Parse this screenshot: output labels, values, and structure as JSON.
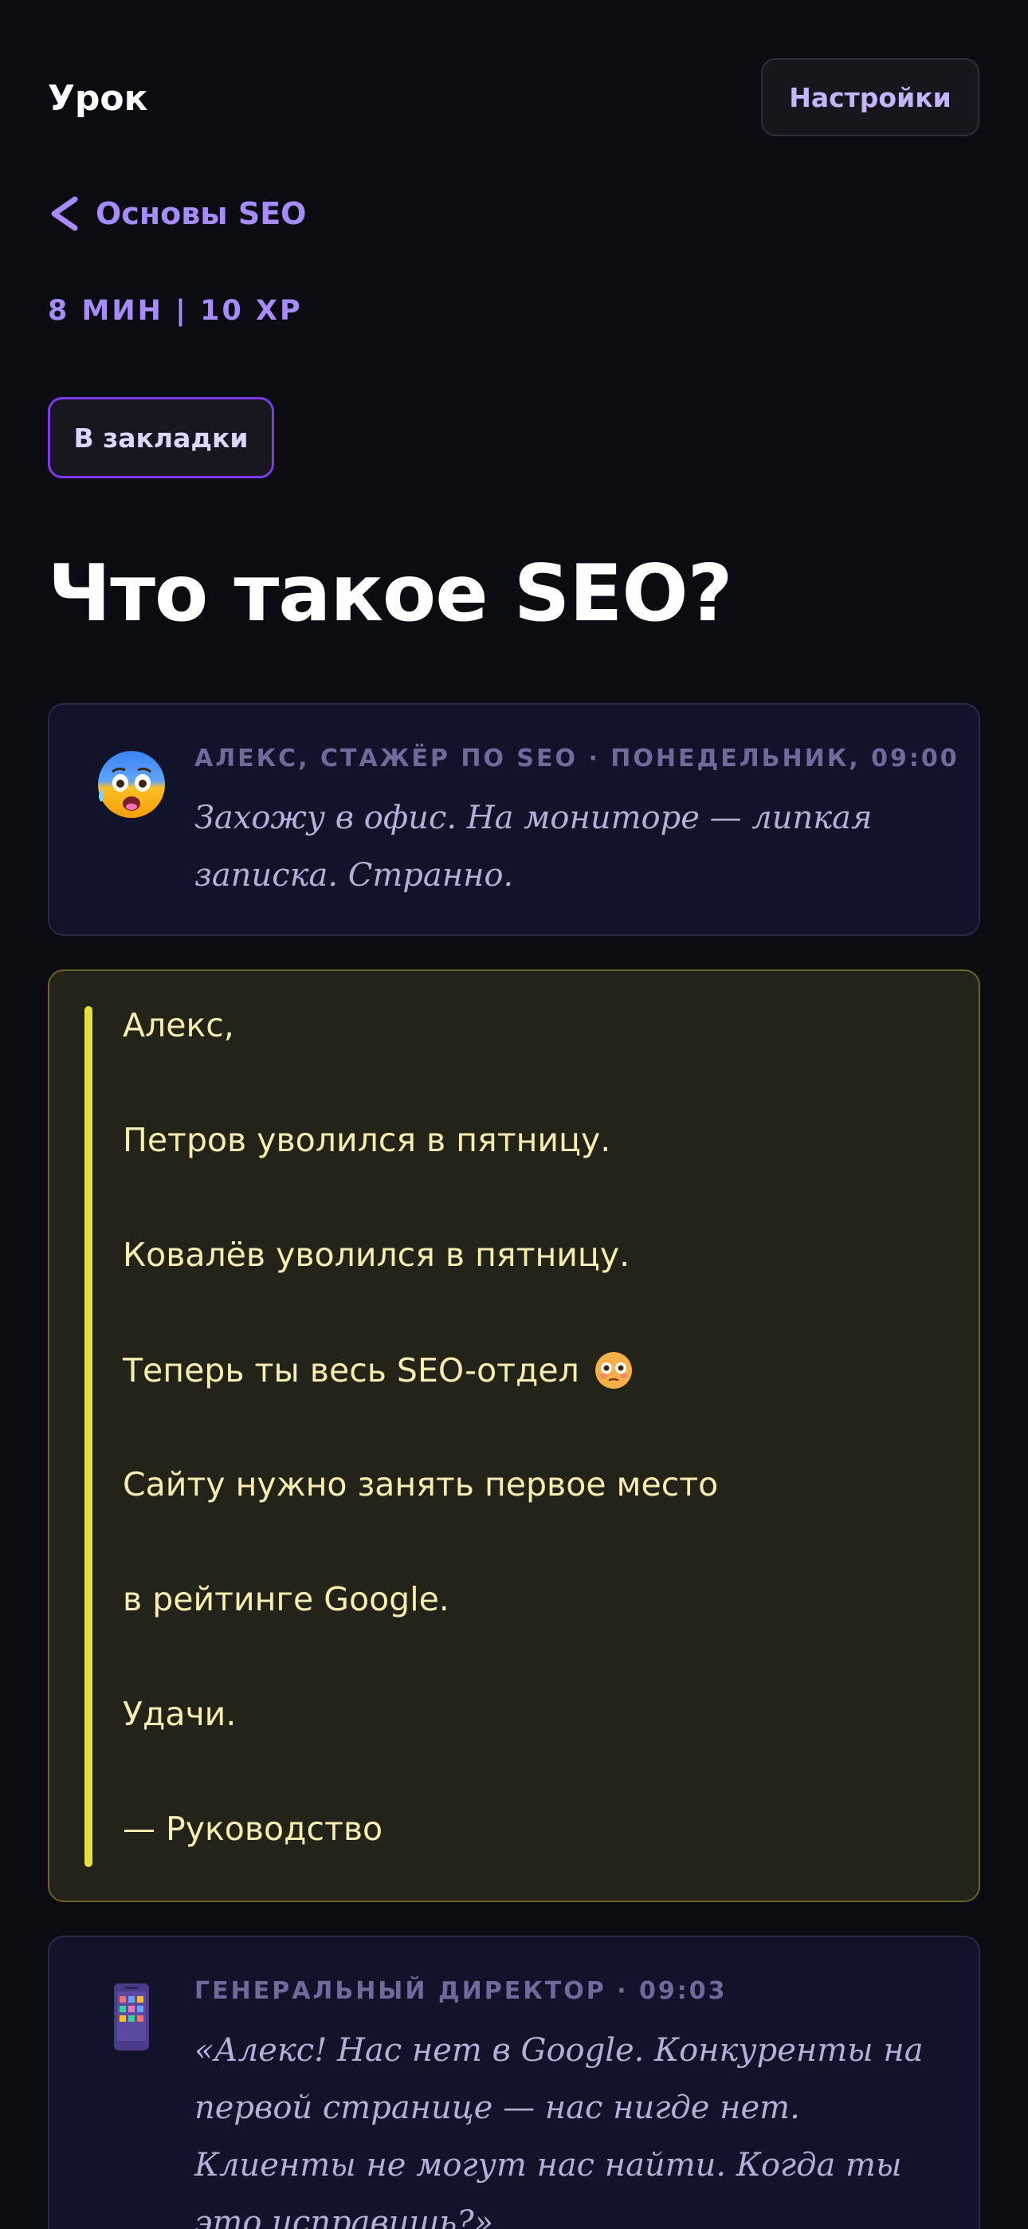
{
  "header": {
    "title": "Урок",
    "settings_label": "Настройки"
  },
  "nav": {
    "back_label": "Основы SEO"
  },
  "lesson": {
    "meta": "8 МИН | 10 XP",
    "bookmark_label": "В закладки",
    "title": "Что такое SEO?"
  },
  "messages": [
    {
      "author": "АЛЕКС, СТАЖЁР ПО SEO · ПОНЕДЕЛЬНИК, 09:00",
      "text": "Захожу в офис. На мониторе — липкая записка. Странно.",
      "avatar_icon": "anxious-face-with-sweat-icon"
    },
    {
      "author": "ГЕНЕРАЛЬНЫЙ ДИРЕКТОР · 09:03",
      "text": "«Алекс! Нас нет в Google. Конкуренты на первой странице — нас нигде нет. Клиенты не могут нас найти. Когда ты это исправишь?»",
      "avatar_icon": "phone-icon"
    }
  ],
  "note": {
    "lines": [
      "Алекс,",
      "Петров уволился в пятницу.",
      "Ковалёв уволился в пятницу.",
      "Теперь ты весь SEO-отдел",
      "Сайту нужно занять первое место",
      "в рейтинге Google.",
      "Удачи.",
      "— Руководство"
    ],
    "emoji_icon": "flushed-face-icon"
  },
  "colors": {
    "background": "#0b0b12",
    "accent": "#a78bfa",
    "note_bar": "#e8e03a",
    "note_text": "#f6eeb0"
  }
}
